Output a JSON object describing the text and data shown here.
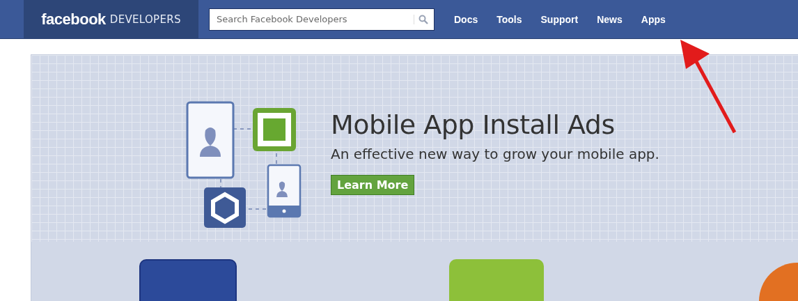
{
  "header": {
    "logo": {
      "brand": "facebook",
      "product": "DEVELOPERS"
    },
    "search": {
      "placeholder": "Search Facebook Developers"
    },
    "nav": [
      {
        "label": "Docs"
      },
      {
        "label": "Tools"
      },
      {
        "label": "Support"
      },
      {
        "label": "News"
      },
      {
        "label": "Apps"
      }
    ]
  },
  "hero": {
    "title": "Mobile App Install Ads",
    "subtitle": "An effective new way to grow your mobile app.",
    "button": "Learn More"
  }
}
